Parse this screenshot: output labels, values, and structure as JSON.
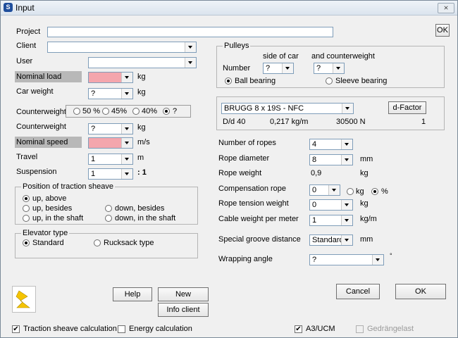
{
  "window": {
    "title": "Input",
    "close_label": "⨯"
  },
  "ok_top": "OK",
  "project": {
    "label": "Project",
    "value": ""
  },
  "client": {
    "label": "Client",
    "value": ""
  },
  "user": {
    "label": "User",
    "value": ""
  },
  "nominal_load": {
    "label": "Nominal load",
    "value": "",
    "unit": "kg"
  },
  "car_weight": {
    "label": "Car weight",
    "value": "?",
    "unit": "kg"
  },
  "counterweight_pct": {
    "label": "Counterweight",
    "options": [
      "50 %",
      "45%",
      "40%",
      "?"
    ],
    "selected": 3
  },
  "counterweight": {
    "label": "Counterweight",
    "value": "?",
    "unit": "kg"
  },
  "nominal_speed": {
    "label": "Nominal speed",
    "value": "",
    "unit": "m/s"
  },
  "travel": {
    "label": "Travel",
    "value": "1",
    "unit": "m"
  },
  "suspension": {
    "label": "Suspension",
    "value": "1",
    "unit": ": 1"
  },
  "traction_sheave": {
    "title": "Position of traction sheave",
    "options": [
      "up, above",
      "up, besides",
      "down, besides",
      "up, in the shaft",
      "down, in the shaft"
    ],
    "selected": 0
  },
  "elevator_type": {
    "title": "Elevator type",
    "options": [
      "Standard",
      "Rucksack type"
    ],
    "selected": 0
  },
  "pulleys": {
    "title": "Pulleys",
    "side_of_car": "side of car",
    "and_counterweight": "and counterweight",
    "number_label": "Number",
    "car_value": "?",
    "cw_value": "?",
    "bearing_options": [
      "Ball bearing",
      "Sleeve bearing"
    ],
    "selected": 0
  },
  "rope": {
    "type": "BRUGG 8 x 19S - NFC",
    "dfactor_button": "d-Factor",
    "dd_label": "D/d 40",
    "weight_per_m": "0,217  kg/m",
    "strength": "30500  N",
    "factor": "1"
  },
  "number_of_ropes": {
    "label": "Number of ropes",
    "value": "4"
  },
  "rope_diameter": {
    "label": "Rope diameter",
    "value": "8",
    "unit": "mm"
  },
  "rope_weight": {
    "label": "Rope weight",
    "value": "0,9",
    "unit": "kg"
  },
  "compensation_rope": {
    "label": "Compensation rope",
    "value": "0",
    "options": [
      "kg",
      "%"
    ],
    "selected": 1
  },
  "rope_tension_weight": {
    "label": "Rope tension weight",
    "value": "0",
    "unit": "kg"
  },
  "cable_weight": {
    "label": "Cable weight per meter",
    "value": "1",
    "unit": "kg/m"
  },
  "special_groove": {
    "label": "Special groove distance",
    "value": "Standard",
    "unit": "mm"
  },
  "wrapping_angle": {
    "label": "Wrapping angle",
    "value": "?",
    "unit": "°"
  },
  "buttons": {
    "help": "Help",
    "new": "New",
    "info_client": "Info client",
    "cancel": "Cancel",
    "ok": "OK"
  },
  "checkboxes": {
    "traction": {
      "label": "Traction sheave calculation",
      "checked": true
    },
    "energy": {
      "label": "Energy calculation",
      "checked": false
    },
    "a3ucm": {
      "label": "A3/UCM",
      "checked": true
    },
    "gedrangelast": {
      "label": "Gedrängelast",
      "checked": false
    }
  }
}
